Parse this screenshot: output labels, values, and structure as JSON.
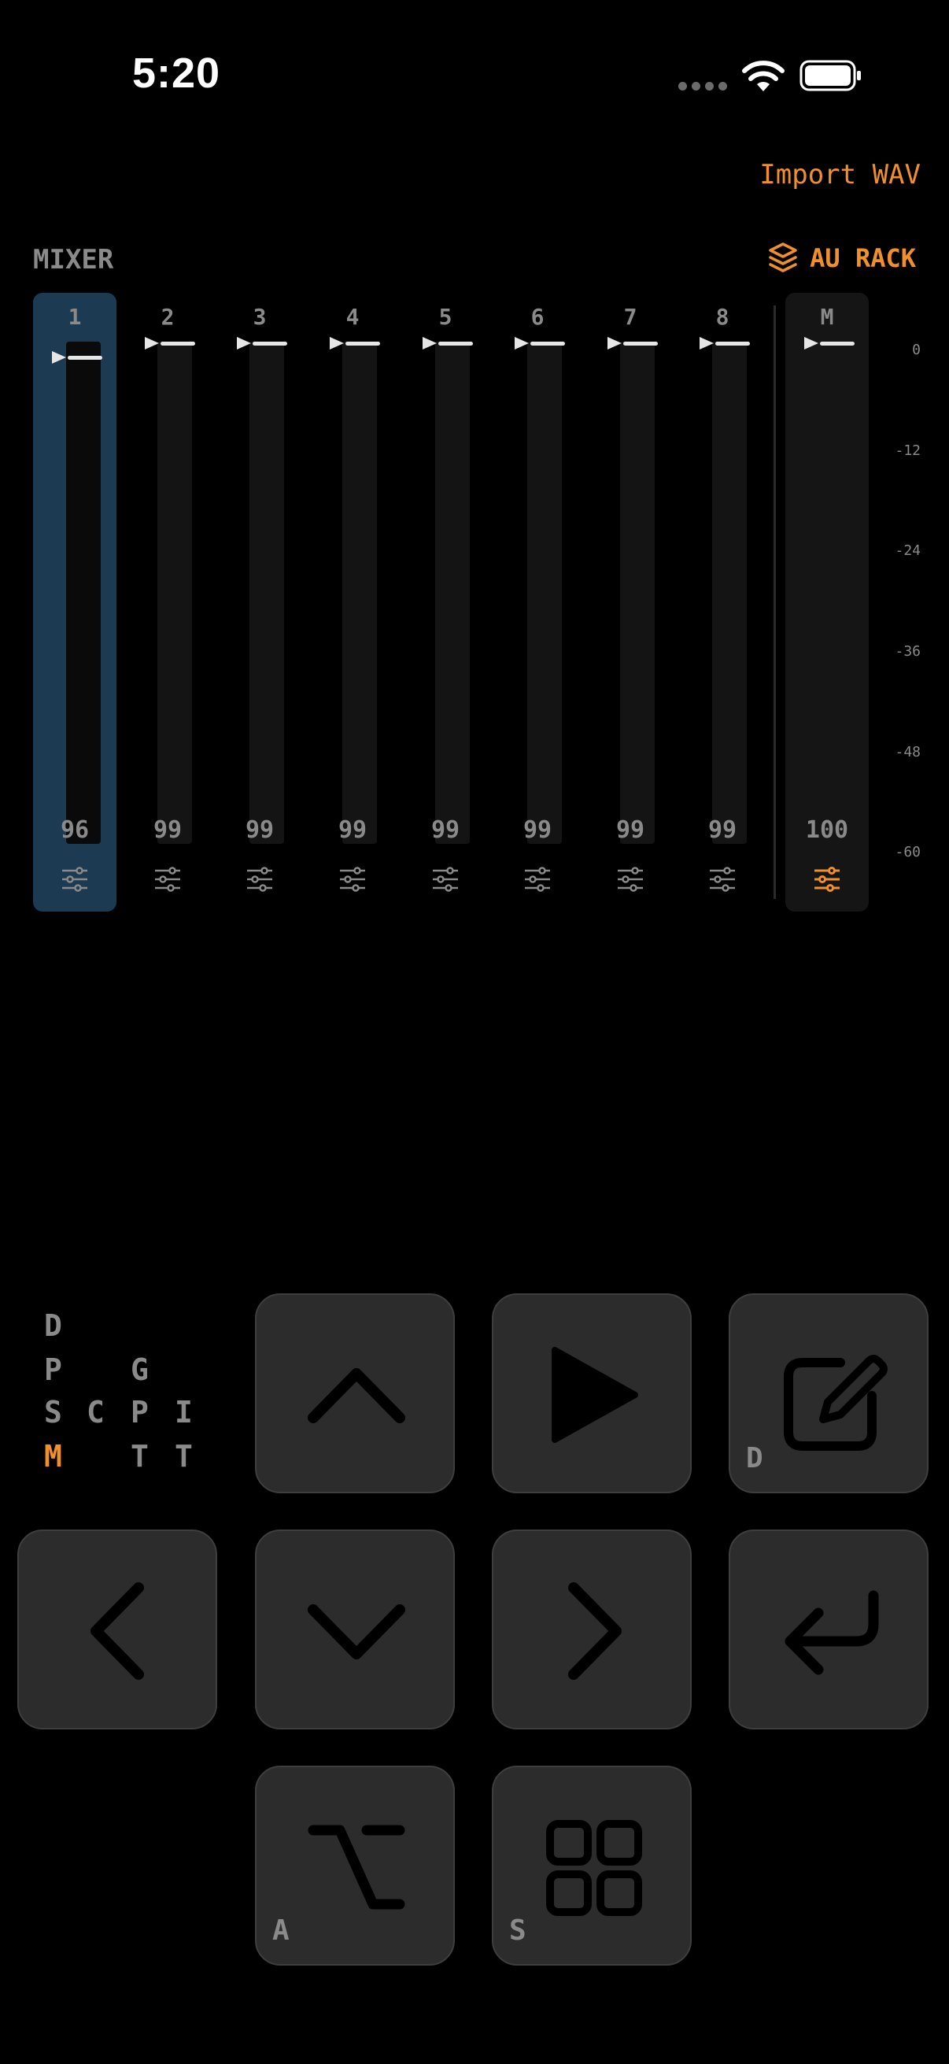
{
  "status": {
    "time": "5:20"
  },
  "header": {
    "import_label": "Import WAV"
  },
  "mixer": {
    "title": "MIXER",
    "au_rack_label": "AU RACK",
    "channels": [
      {
        "label": "1",
        "value": "96"
      },
      {
        "label": "2",
        "value": "99"
      },
      {
        "label": "3",
        "value": "99"
      },
      {
        "label": "4",
        "value": "99"
      },
      {
        "label": "5",
        "value": "99"
      },
      {
        "label": "6",
        "value": "99"
      },
      {
        "label": "7",
        "value": "99"
      },
      {
        "label": "8",
        "value": "99"
      }
    ],
    "master": {
      "label": "M",
      "value": "100"
    },
    "db_scale": [
      "0",
      "-12",
      "-24",
      "-36",
      "-48",
      "-60"
    ],
    "selected_channel": "1"
  },
  "modes": {
    "col1": [
      "D",
      "P",
      "S",
      "M"
    ],
    "col2": [
      "C"
    ],
    "col3": [
      "G",
      "P",
      "T"
    ],
    "col4": [
      "I",
      "T"
    ],
    "active": "M"
  },
  "keypad": {
    "up": {
      "icon": "chevron-up-icon"
    },
    "play": {
      "icon": "play-icon"
    },
    "edit": {
      "icon": "edit-icon",
      "hint": "D"
    },
    "left": {
      "icon": "chevron-left-icon"
    },
    "down": {
      "icon": "chevron-down-icon"
    },
    "right": {
      "icon": "chevron-right-icon"
    },
    "enter": {
      "icon": "return-icon"
    },
    "option": {
      "icon": "option-key-icon",
      "hint": "A"
    },
    "grid": {
      "icon": "grid-icon",
      "hint": "S"
    }
  },
  "colors": {
    "accent": "#f0902a",
    "selected_strip": "#1c3a52",
    "key_bg": "#2c2c2c",
    "text_dim": "#8a8a8a"
  }
}
